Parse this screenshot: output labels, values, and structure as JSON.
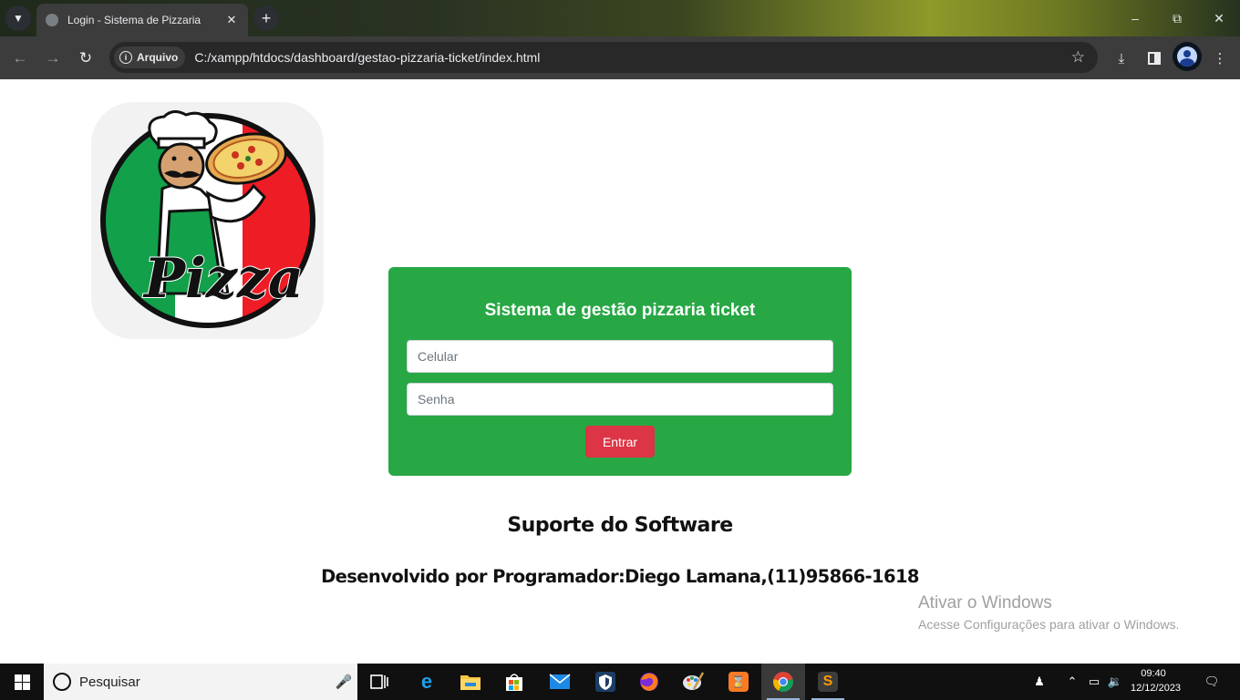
{
  "browser": {
    "tab_title": "Login - Sistema de Pizzaria",
    "security_chip": "Arquivo",
    "url": "C:/xampp/htdocs/dashboard/gestao-pizzaria-ticket/index.html"
  },
  "page": {
    "logo_text": "Pizza",
    "login": {
      "title": "Sistema de gestão pizzaria ticket",
      "phone_placeholder": "Celular",
      "password_placeholder": "Senha",
      "submit_label": "Entrar"
    },
    "support": {
      "title": "Suporte do Software",
      "developer": "Desenvolvido por Programador:Diego Lamana,(11)95866-1618"
    }
  },
  "watermark": {
    "title": "Ativar o Windows",
    "subtitle": "Acesse Configurações para ativar o Windows."
  },
  "taskbar": {
    "search_placeholder": "Pesquisar",
    "time": "09:40",
    "date": "12/12/2023"
  },
  "colors": {
    "card_green": "#28a745",
    "button_red": "#dc3545"
  }
}
